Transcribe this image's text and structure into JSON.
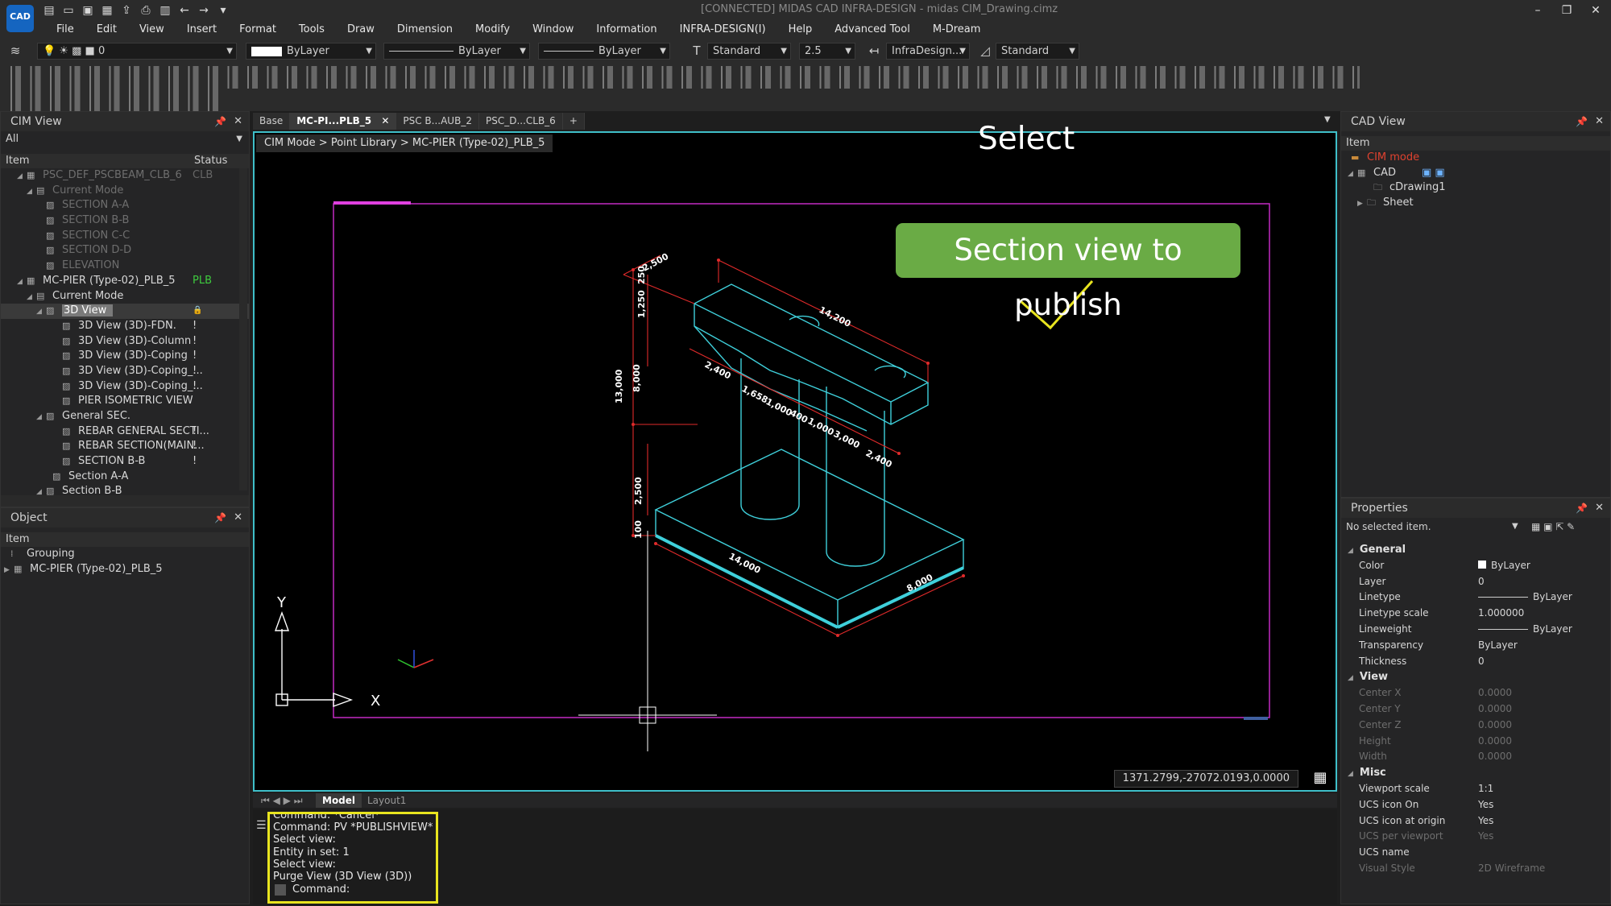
{
  "app": {
    "logo_text": "CAD",
    "title": "[CONNECTED] MIDAS CAD INFRA-DESIGN - midas CIM_Drawing.cimz",
    "menu": [
      "File",
      "Edit",
      "View",
      "Insert",
      "Format",
      "Tools",
      "Draw",
      "Dimension",
      "Modify",
      "Window",
      "Information",
      "INFRA-DESIGN(I)",
      "Help",
      "Advanced Tool",
      "M-Dream"
    ]
  },
  "toolbar": {
    "layer_value": "0",
    "color_value": "ByLayer",
    "linetype_value": "ByLayer",
    "lineweight_value": "ByLayer",
    "text_style": "Standard",
    "text_height": "2.5",
    "dim_style": "InfraDesign...",
    "table_style": "Standard"
  },
  "cim_view": {
    "title": "CIM View",
    "filter": "All",
    "col_item": "Item",
    "col_status": "Status",
    "rows": [
      {
        "label": "PSC_DEF_PSCBEAM_CLB_6",
        "status": "CLB",
        "dim": true
      },
      {
        "label": "Current Mode",
        "status": "",
        "dim": true
      },
      {
        "label": "SECTION A-A",
        "status": "",
        "dim": true
      },
      {
        "label": "SECTION B-B",
        "status": "",
        "dim": true
      },
      {
        "label": "SECTION C-C",
        "status": "",
        "dim": true
      },
      {
        "label": "SECTION D-D",
        "status": "",
        "dim": true
      },
      {
        "label": "ELEVATION",
        "status": "",
        "dim": true
      },
      {
        "label": "MC-PIER (Type-02)_PLB_5",
        "status": "PLB",
        "dim": false
      },
      {
        "label": "Current Mode",
        "status": "",
        "dim": false
      },
      {
        "label": "3D View",
        "status": "🔒",
        "dim": false
      },
      {
        "label": "3D View (3D)-FDN.",
        "status": "!",
        "dim": false
      },
      {
        "label": "3D View (3D)-Column",
        "status": "!",
        "dim": false
      },
      {
        "label": "3D View (3D)-Coping",
        "status": "!",
        "dim": false
      },
      {
        "label": "3D View (3D)-Coping_...",
        "status": "!",
        "dim": false
      },
      {
        "label": "3D View (3D)-Coping_...",
        "status": "!",
        "dim": false
      },
      {
        "label": "PIER ISOMETRIC VIEW",
        "status": "",
        "dim": false
      },
      {
        "label": "General SEC.",
        "status": "",
        "dim": false
      },
      {
        "label": "REBAR GENERAL SECTI...",
        "status": "!",
        "dim": false
      },
      {
        "label": "REBAR SECTION(MAIN...",
        "status": "!",
        "dim": false
      },
      {
        "label": "SECTION B-B",
        "status": "!",
        "dim": false
      },
      {
        "label": "Section A-A",
        "status": "",
        "dim": false
      },
      {
        "label": "Section B-B",
        "status": "",
        "dim": false
      }
    ]
  },
  "object_panel": {
    "title": "Object",
    "col_item": "Item",
    "rows": [
      {
        "label": "Grouping"
      },
      {
        "label": "MC-PIER (Type-02)_PLB_5"
      }
    ]
  },
  "document_tabs": [
    "Base",
    "MC-PI...PLB_5",
    "PSC B...AUB_2",
    "PSC_D...CLB_6"
  ],
  "viewport": {
    "breadcrumb": "CIM Mode > Point Library > MC-PIER (Type-02)_PLB_5",
    "coords": "1371.2799,-27072.0193,0.0000",
    "select_annotation": "Select",
    "callout": "Section view to publish",
    "axis_y": "Y",
    "axis_x": "X",
    "dims": [
      "2,500",
      "1,250",
      "250",
      "14,200",
      "13,000",
      "8,000",
      "2,400",
      "1,658",
      "1,000",
      "400",
      "1,000",
      "3,000",
      "2,400",
      "2,500",
      "100",
      "14,000",
      "8,000"
    ]
  },
  "layout_tabs": [
    "Model",
    "Layout1"
  ],
  "command": {
    "lines": [
      "Command: *Cancel*",
      "Command:  PV *PUBLISHVIEW*",
      "Select view:",
      "Entity in set: 1",
      "Select view:",
      "Purge View (3D View (3D))"
    ],
    "prompt": "Command:"
  },
  "cad_view": {
    "title": "CAD View",
    "col_item": "Item",
    "rows": [
      {
        "label": "CIM mode",
        "color": "#e0422f"
      },
      {
        "label": "CAD",
        "color": "#d8d8d8"
      },
      {
        "label": "cDrawing1",
        "color": "#d8d8d8"
      },
      {
        "label": "Sheet",
        "color": "#d8d8d8"
      }
    ]
  },
  "properties": {
    "title": "Properties",
    "selection": "No selected item.",
    "sections": [
      {
        "name": "General",
        "rows": [
          {
            "k": "Color",
            "v": "ByLayer",
            "dim": false
          },
          {
            "k": "Layer",
            "v": "0",
            "dim": false
          },
          {
            "k": "Linetype",
            "v": "ByLayer",
            "dim": false
          },
          {
            "k": "Linetype scale",
            "v": "1.000000",
            "dim": false
          },
          {
            "k": "Lineweight",
            "v": "ByLayer",
            "dim": false
          },
          {
            "k": "Transparency",
            "v": "ByLayer",
            "dim": false
          },
          {
            "k": "Thickness",
            "v": "0",
            "dim": false
          }
        ]
      },
      {
        "name": "View",
        "rows": [
          {
            "k": "Center X",
            "v": "0.0000",
            "dim": true
          },
          {
            "k": "Center Y",
            "v": "0.0000",
            "dim": true
          },
          {
            "k": "Center Z",
            "v": "0.0000",
            "dim": true
          },
          {
            "k": "Height",
            "v": "0.0000",
            "dim": true
          },
          {
            "k": "Width",
            "v": "0.0000",
            "dim": true
          }
        ]
      },
      {
        "name": "Misc",
        "rows": [
          {
            "k": "Viewport scale",
            "v": "1:1",
            "dim": false
          },
          {
            "k": "UCS icon On",
            "v": "Yes",
            "dim": false
          },
          {
            "k": "UCS icon at origin",
            "v": "Yes",
            "dim": false
          },
          {
            "k": "UCS per viewport",
            "v": "Yes",
            "dim": true
          },
          {
            "k": "UCS name",
            "v": "",
            "dim": false
          },
          {
            "k": "Visual Style",
            "v": "2D Wireframe",
            "dim": true
          }
        ]
      }
    ]
  }
}
